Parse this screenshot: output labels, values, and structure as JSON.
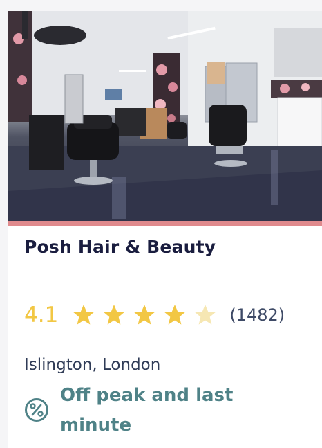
{
  "listing": {
    "name": "Posh Hair & Beauty",
    "rating_value": "4.1",
    "rating": 4.1,
    "max_rating": 5,
    "review_count": "(1482)",
    "location": "Islington, London",
    "offer_text": "Off peak and last minute",
    "icons": {
      "offer": "percent-badge-icon",
      "star": "star-icon"
    },
    "colors": {
      "accent_bar": "#e08a8d",
      "title": "#1a1d3f",
      "rating": "#f2c744",
      "star_empty": "#f6e7b3",
      "offer": "#4f8287"
    }
  }
}
